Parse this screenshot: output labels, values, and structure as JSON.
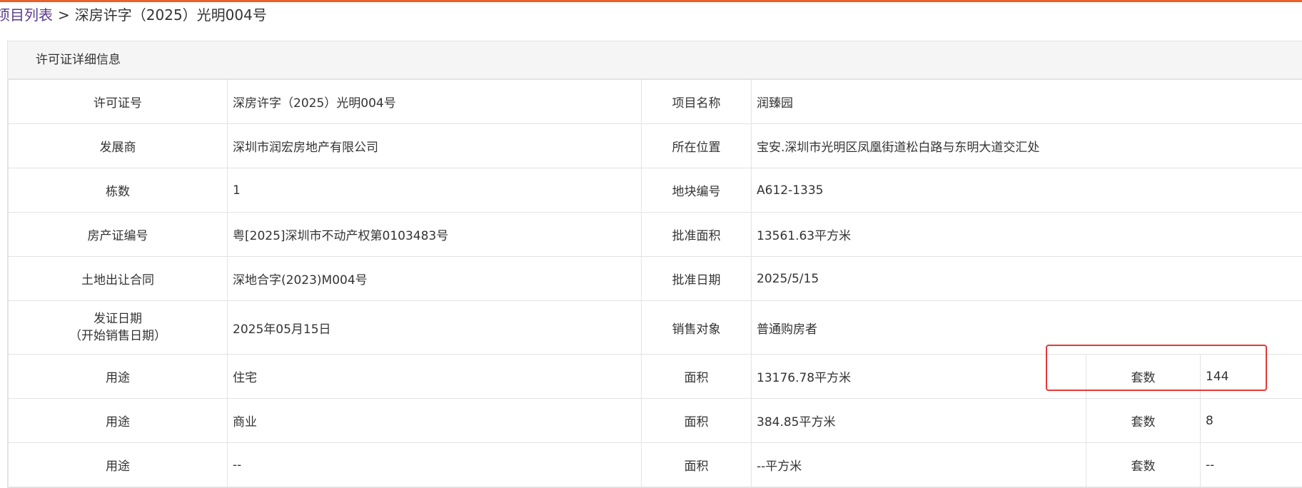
{
  "accent_color": "#e8622a",
  "highlight_color": "#e53935",
  "breadcrumb": {
    "link": "项目列表",
    "separator": ">",
    "current": "深房许字（2025）光明004号"
  },
  "panel": {
    "title": "许可证详细信息"
  },
  "details": {
    "permit_no_label": "许可证号",
    "permit_no_value": "深房许字（2025）光明004号",
    "project_name_label": "项目名称",
    "project_name_value": "润臻园",
    "developer_label": "发展商",
    "developer_value": "深圳市润宏房地产有限公司",
    "location_label": "所在位置",
    "location_value": "宝安.深圳市光明区凤凰街道松白路与东明大道交汇处",
    "buildings_label": "栋数",
    "buildings_value": "1",
    "parcel_no_label": "地块编号",
    "parcel_no_value": "A612-1335",
    "property_cert_label": "房产证编号",
    "property_cert_value": "粤[2025]深圳市不动产权第0103483号",
    "approved_area_label": "批准面积",
    "approved_area_value": "13561.63平方米",
    "land_contract_label": "土地出让合同",
    "land_contract_value": "深地合字(2023)M004号",
    "approved_date_label": "批准日期",
    "approved_date_value": "2025/5/15",
    "issue_date_label_line1": "发证日期",
    "issue_date_label_line2": "（开始销售日期）",
    "issue_date_value": "2025年05月15日",
    "sales_target_label": "销售对象",
    "sales_target_value": "普通购房者"
  },
  "usage_rows": [
    {
      "usage_label": "用途",
      "usage": "住宅",
      "area_label": "面积",
      "area": "13176.78平方米",
      "units_label": "套数",
      "units": "144"
    },
    {
      "usage_label": "用途",
      "usage": "商业",
      "area_label": "面积",
      "area": "384.85平方米",
      "units_label": "套数",
      "units": "8"
    },
    {
      "usage_label": "用途",
      "usage": "--",
      "area_label": "面积",
      "area": "--平方米",
      "units_label": "套数",
      "units": "--"
    }
  ]
}
